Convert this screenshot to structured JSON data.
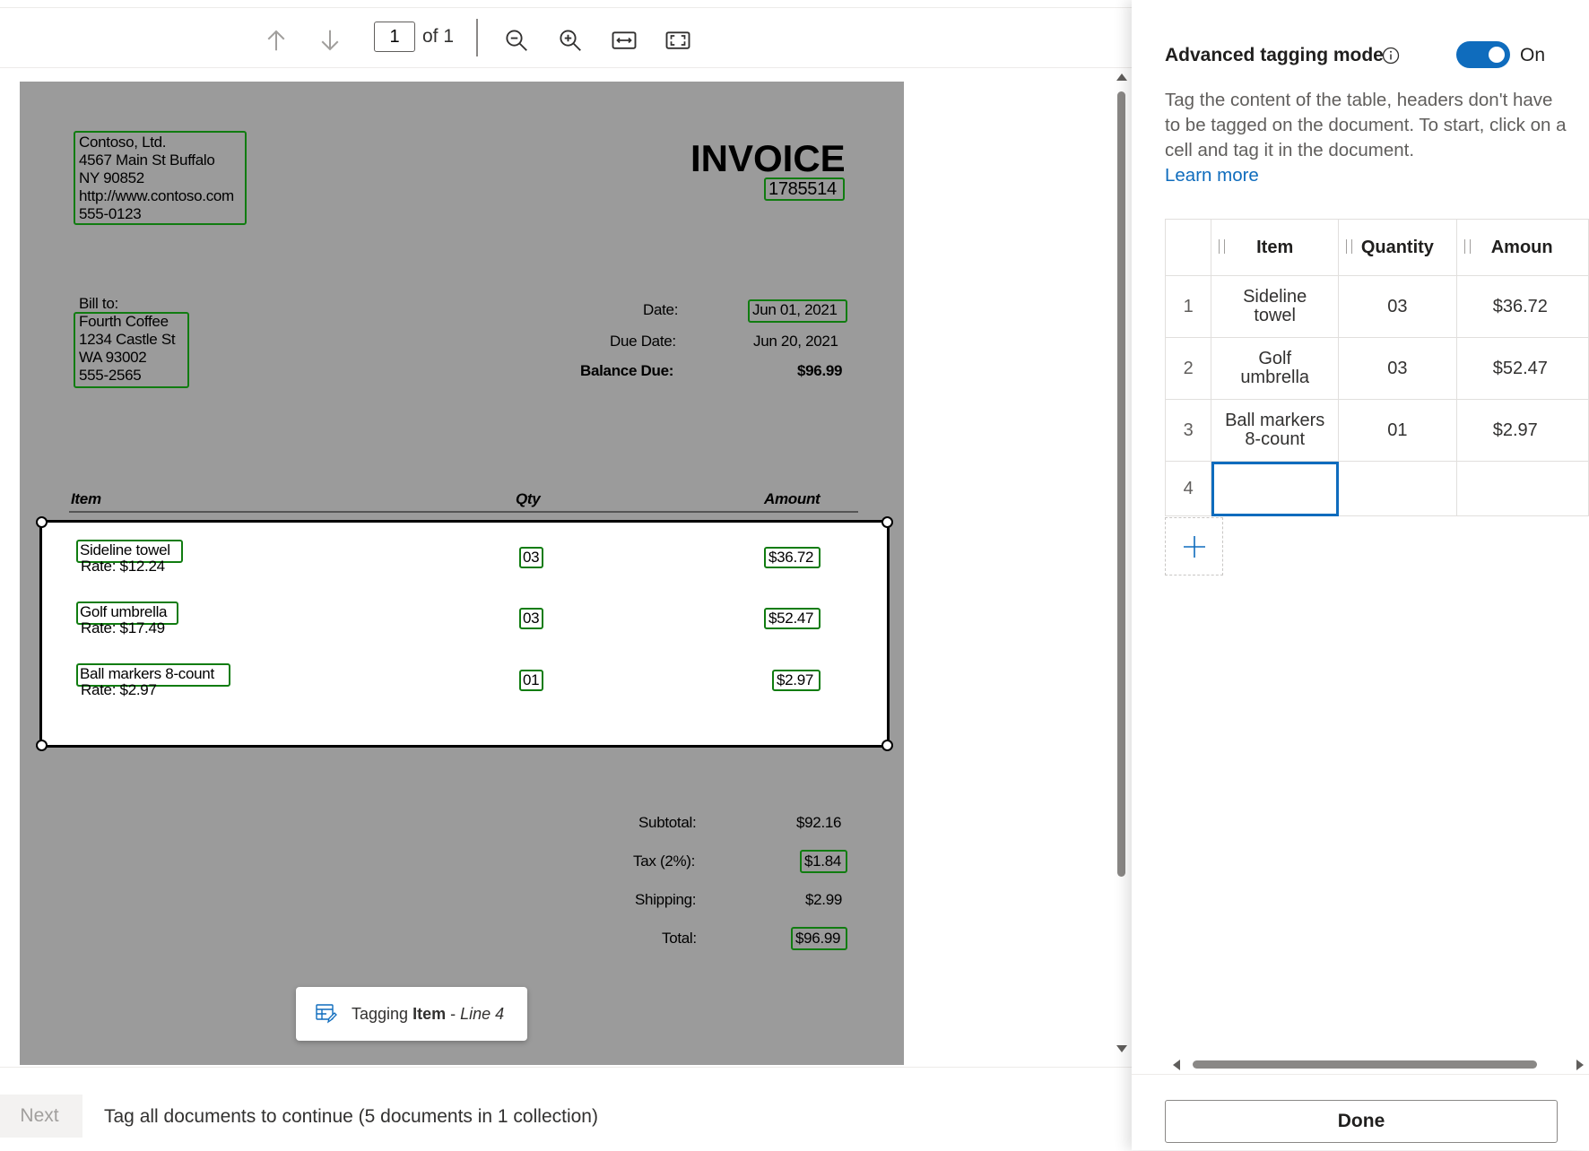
{
  "toolbar": {
    "page_number": "1",
    "page_of": "of 1",
    "icons": [
      "arrow-up-icon",
      "arrow-down-icon",
      "zoom-out-icon",
      "zoom-in-icon",
      "fit-width-icon",
      "fit-page-icon"
    ]
  },
  "document": {
    "company_lines": [
      "Contoso, Ltd.",
      "4567 Main St Buffalo",
      "NY 90852",
      "http://www.contoso.com",
      "555-0123"
    ],
    "invoice_title": "INVOICE",
    "invoice_number": "1785514",
    "bill_to_label": "Bill to:",
    "bill_to_lines": [
      "Fourth Coffee",
      "1234 Castle St",
      "WA 93002",
      "555-2565"
    ],
    "date_label": "Date:",
    "date_value": "Jun 01, 2021",
    "due_date_label": "Due Date:",
    "due_date_value": "Jun 20, 2021",
    "balance_due_label": "Balance Due:",
    "balance_due_value": "$96.99",
    "col_item": "Item",
    "col_qty": "Qty",
    "col_amount": "Amount",
    "lines": [
      {
        "item": "Sideline towel",
        "rate": "Rate: $12.24",
        "qty": "03",
        "amount": "$36.72"
      },
      {
        "item": "Golf umbrella",
        "rate": "Rate: $17.49",
        "qty": "03",
        "amount": "$52.47"
      },
      {
        "item": "Ball markers 8-count",
        "rate": "Rate: $2.97",
        "qty": "01",
        "amount": "$2.97"
      }
    ],
    "subtotal_label": "Subtotal:",
    "subtotal_value": "$92.16",
    "tax_label": "Tax (2%):",
    "tax_value": "$1.84",
    "shipping_label": "Shipping:",
    "shipping_value": "$2.99",
    "total_label": "Total:",
    "total_value": "$96.99"
  },
  "toast": {
    "prefix": "Tagging",
    "field": "Item",
    "sep": " - ",
    "line": "Line 4"
  },
  "bottom": {
    "next_label": "Next",
    "message": "Tag all documents to continue (5 documents in 1 collection)"
  },
  "panel": {
    "advanced_label": "Advanced tagging mode",
    "toggle_label": "On",
    "description": "Tag the content of the table, headers don't have to be tagged on the document. To start, click on a cell and tag it in the document.",
    "learn_more": "Learn more",
    "columns": [
      "Item",
      "Quantity",
      "Amoun"
    ],
    "rows": [
      {
        "num": "1",
        "item": "Sideline towel",
        "qty": "03",
        "amount": "$36.72"
      },
      {
        "num": "2",
        "item": "Golf umbrella",
        "qty": "03",
        "amount": "$52.47"
      },
      {
        "num": "3",
        "item": "Ball markers 8-count",
        "qty": "01",
        "amount": "$2.97"
      },
      {
        "num": "4",
        "item": "",
        "qty": "",
        "amount": ""
      }
    ],
    "done_label": "Done"
  },
  "colors": {
    "accent": "#0f6cbd",
    "tag_border": "#107c10",
    "page_bg": "#9b9b9b"
  }
}
